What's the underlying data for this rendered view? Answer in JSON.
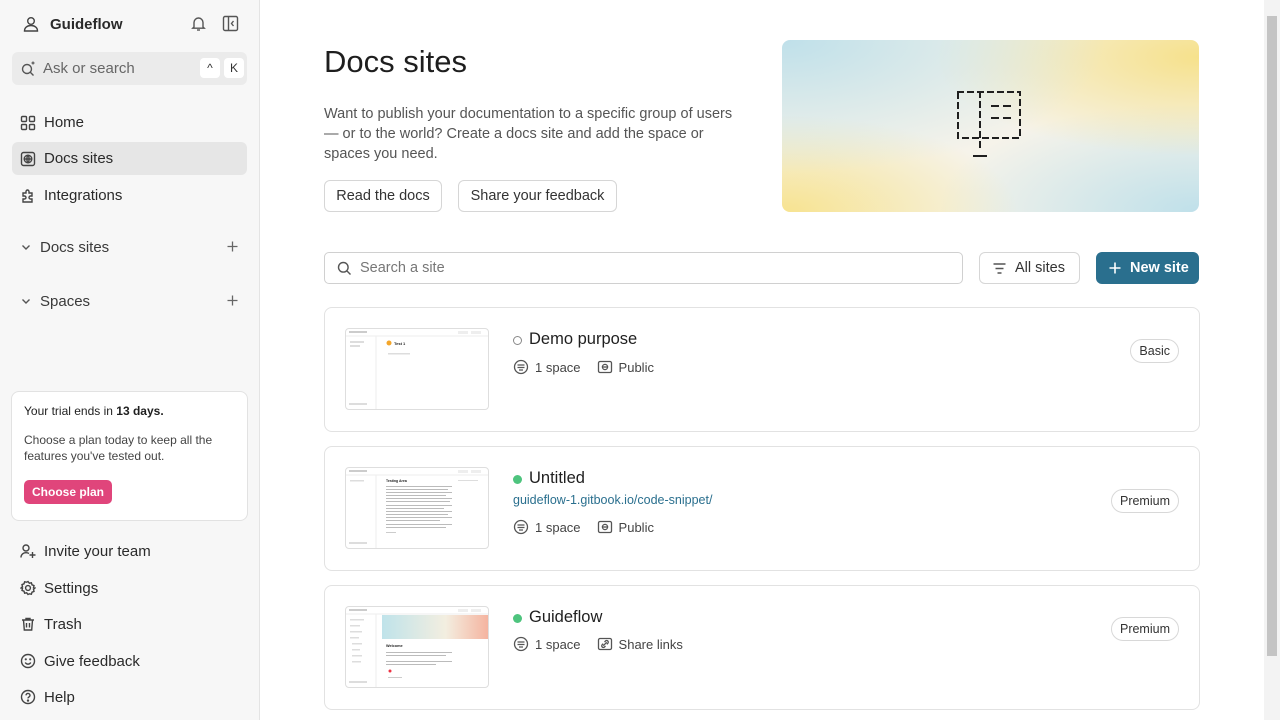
{
  "sidebar": {
    "workspace_name": "Guideflow",
    "search_placeholder": "Ask or search",
    "shortcut_keys": [
      "^",
      "K"
    ],
    "nav": [
      {
        "label": "Home",
        "icon": "grid-icon"
      },
      {
        "label": "Docs sites",
        "icon": "globe-icon",
        "active": true
      },
      {
        "label": "Integrations",
        "icon": "puzzle-icon"
      }
    ],
    "sections": [
      {
        "label": "Docs sites"
      },
      {
        "label": "Spaces"
      }
    ],
    "trial": {
      "prefix": "Your trial ends in ",
      "days": "13 days.",
      "body": "Choose a plan today to keep all the features you've tested out.",
      "cta": "Choose plan"
    },
    "bottom": [
      {
        "label": "Invite your team",
        "icon": "add-user-icon"
      },
      {
        "label": "Settings",
        "icon": "gear-icon"
      },
      {
        "label": "Trash",
        "icon": "trash-icon"
      },
      {
        "label": "Give feedback",
        "icon": "smile-icon"
      },
      {
        "label": "Help",
        "icon": "help-icon"
      }
    ]
  },
  "main": {
    "title": "Docs sites",
    "description": "Want to publish your documentation to a specific group of users — or to the world? Create a docs site and add the space or spaces you need.",
    "read_docs": "Read the docs",
    "share_feedback": "Share your feedback",
    "search_placeholder": "Search a site",
    "filter_label": "All sites",
    "new_site_label": "New site"
  },
  "sites": [
    {
      "name": "Demo purpose",
      "status": "unpublished",
      "url": "",
      "spaces": "1 space",
      "visibility": "Public",
      "plan": "Basic",
      "thumb_title": "Test 1"
    },
    {
      "name": "Untitled",
      "status": "published",
      "url": "guideflow-1.gitbook.io/code-snippet/",
      "spaces": "1 space",
      "visibility": "Public",
      "plan": "Premium",
      "thumb_title": "Testing Area"
    },
    {
      "name": "Guideflow",
      "status": "published",
      "url": "",
      "spaces": "1 space",
      "visibility": "Share links",
      "plan": "Premium",
      "thumb_title": "Welcome"
    }
  ],
  "colors": {
    "accent": "#2a6f8e",
    "cta": "#e0457b",
    "published": "#4ec47e"
  }
}
